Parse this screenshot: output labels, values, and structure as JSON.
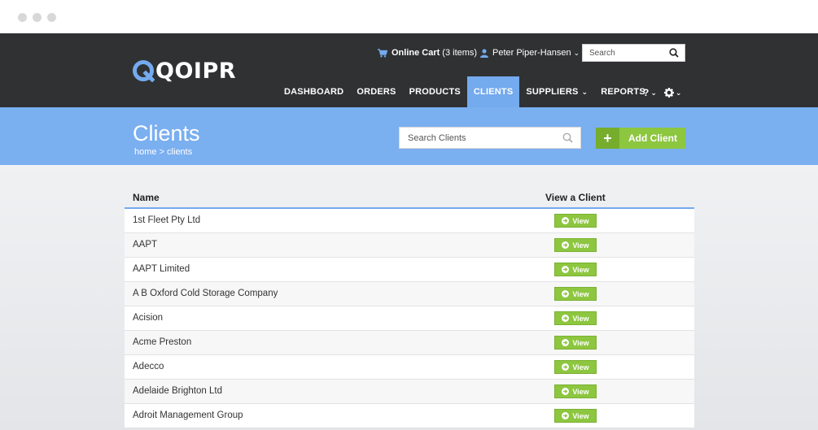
{
  "brand": {
    "logo_text": "QOIPR",
    "accent": "#74aaee",
    "green": "#8dc63f",
    "dark": "#2f3133"
  },
  "header": {
    "cart_label": "Online Cart",
    "cart_count": "(3 items)",
    "user_name": "Peter Piper-Hansen",
    "search_placeholder": "Search",
    "help_label": "?"
  },
  "nav": {
    "items": [
      {
        "label": "DASHBOARD"
      },
      {
        "label": "ORDERS"
      },
      {
        "label": "PRODUCTS"
      },
      {
        "label": "CLIENTS",
        "active": true
      },
      {
        "label": "SUPPLIERS",
        "has_dropdown": true
      },
      {
        "label": "REPORTS"
      }
    ]
  },
  "page": {
    "title": "Clients",
    "breadcrumb": "home > clients",
    "search_placeholder": "Search Clients",
    "add_button_label": "Add Client"
  },
  "table": {
    "columns": [
      "Name",
      "View a Client"
    ],
    "view_label": "View",
    "rows": [
      {
        "name": "1st Fleet Pty Ltd"
      },
      {
        "name": "AAPT"
      },
      {
        "name": "AAPT Limited"
      },
      {
        "name": "A B Oxford Cold Storage Company"
      },
      {
        "name": "Acision"
      },
      {
        "name": "Acme Preston"
      },
      {
        "name": "Adecco"
      },
      {
        "name": "Adelaide Brighton Ltd"
      },
      {
        "name": "Adroit Management Group"
      }
    ]
  }
}
